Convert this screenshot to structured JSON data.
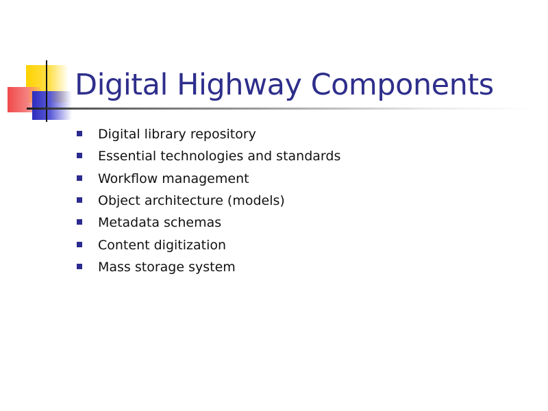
{
  "slide": {
    "title": "Digital Highway Components",
    "bullets": [
      "Digital library repository",
      "Essential technologies and standards",
      "Workflow management",
      "Object architecture (models)",
      "Metadata schemas",
      "Content digitization",
      "Mass storage system"
    ],
    "bullet_icon": "square-bullet-icon"
  },
  "colors": {
    "title": "#2e2e8c",
    "bullet": "#2b2b8f",
    "text": "#111111",
    "accent_yellow": "#ffd200",
    "accent_red": "#f04a4a",
    "accent_blue": "#2d2dbd"
  }
}
